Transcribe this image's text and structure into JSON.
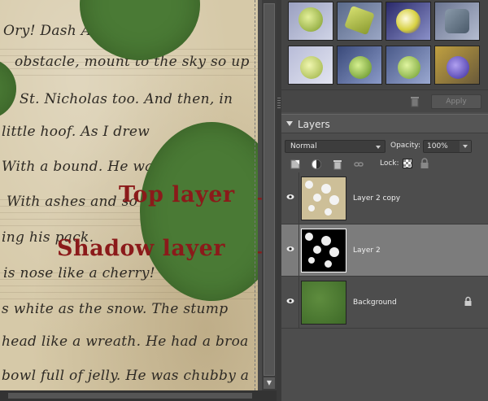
{
  "canvas": {
    "script_lines": [
      "Ory!  Dash                As dry",
      "obstacle, mount to the sky so up",
      "St. Nicholas too. And then, in",
      "little hoof. As I drew",
      "With a bound. He was",
      "With ashes and so",
      "ing his pack.",
      "is nose like a cherry!",
      "s white as the snow. The stump",
      "head like a wreath. He had a broa",
      "bowl full of jelly. He was chubby a"
    ],
    "annotations": {
      "top_label": "Top layer",
      "shadow_label": "Shadow layer",
      "arrow": "->"
    }
  },
  "effects_panel": {
    "thumbnails": [
      "apple-effect-1",
      "apple-effect-2",
      "apple-effect-3",
      "apple-effect-4",
      "apple-effect-5",
      "apple-effect-6",
      "apple-effect-7",
      "apple-effect-8"
    ],
    "trash_icon": "trash-icon",
    "apply_label": "Apply"
  },
  "layers_panel": {
    "title": "Layers",
    "blend_mode": "Normal",
    "opacity_label": "Opacity:",
    "opacity_value": "100%",
    "lock_label": "Lock:",
    "layers": [
      {
        "name": "Layer 2 copy",
        "selected": false,
        "locked": false
      },
      {
        "name": "Layer 2",
        "selected": true,
        "locked": false
      },
      {
        "name": "Background",
        "selected": false,
        "locked": true
      }
    ]
  },
  "colors": {
    "annotation": "#8b1a1a",
    "dot_green": "#4a7a35",
    "paper": "#d6c9a8",
    "panel": "#4d4d4d",
    "selected_row": "#7c7c7c"
  }
}
